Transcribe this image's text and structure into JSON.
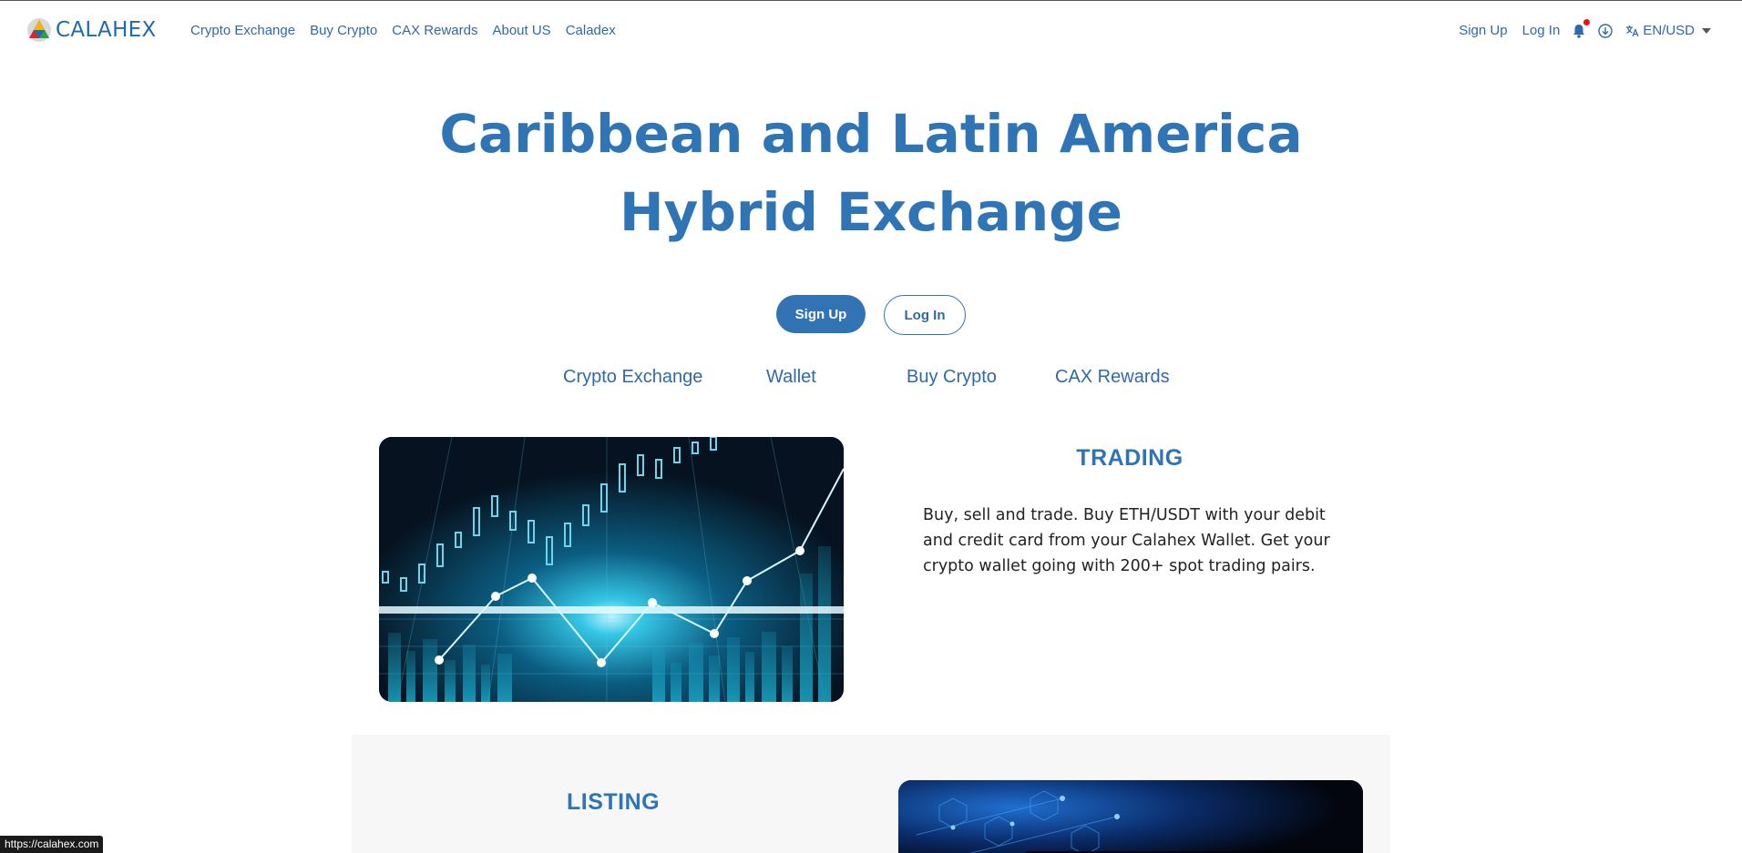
{
  "header": {
    "brand": "CALAHEX",
    "nav": [
      "Crypto Exchange",
      "Buy Crypto",
      "CAX Rewards",
      "About US",
      "Caladex"
    ],
    "signup": "Sign Up",
    "login": "Log In",
    "lang": "EN/USD"
  },
  "hero": {
    "title_line1": "Caribbean and Latin America",
    "title_line2": "Hybrid Exchange",
    "signup_button": "Sign Up",
    "login_button": "Log In"
  },
  "tabs": [
    "Crypto Exchange",
    "Wallet",
    "Buy Crypto",
    "CAX Rewards"
  ],
  "trading": {
    "title": "TRADING",
    "text": "Buy, sell and trade. Buy ETH/USDT with your debit and credit card from your Calahex Wallet. Get your crypto wallet going with 200+ spot trading pairs."
  },
  "listing": {
    "title": "LISTING"
  },
  "status_url": "https://calahex.com",
  "colors": {
    "brand_blue": "#2f75b5",
    "link_blue": "#2f6aa8",
    "button_blue": "#3273b4",
    "notification_red": "#ee1111"
  }
}
